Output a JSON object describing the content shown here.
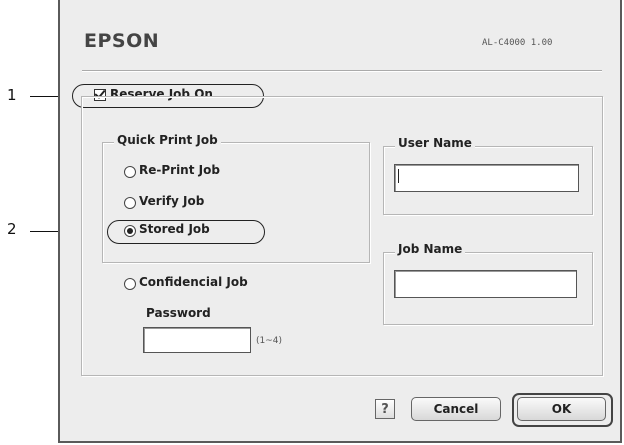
{
  "dialog": {
    "brand": "EPSON",
    "model": "AL-C4000 1.00"
  },
  "reserve": {
    "label": "Reserve Job On",
    "checked": true
  },
  "quick_print": {
    "legend": "Quick Print Job",
    "options": [
      {
        "label": "Re-Print Job",
        "selected": false
      },
      {
        "label": "Verify Job",
        "selected": false
      },
      {
        "label": "Stored Job",
        "selected": true
      }
    ]
  },
  "confidential": {
    "label": "Confidencial Job",
    "selected": false,
    "password_label": "Password",
    "password_value": "",
    "password_hint": "(1~4)"
  },
  "user_name": {
    "legend": "User Name",
    "value": ""
  },
  "job_name": {
    "legend": "Job Name",
    "value": ""
  },
  "buttons": {
    "help": "?",
    "cancel": "Cancel",
    "ok": "OK"
  },
  "callouts": [
    "1",
    "2"
  ]
}
